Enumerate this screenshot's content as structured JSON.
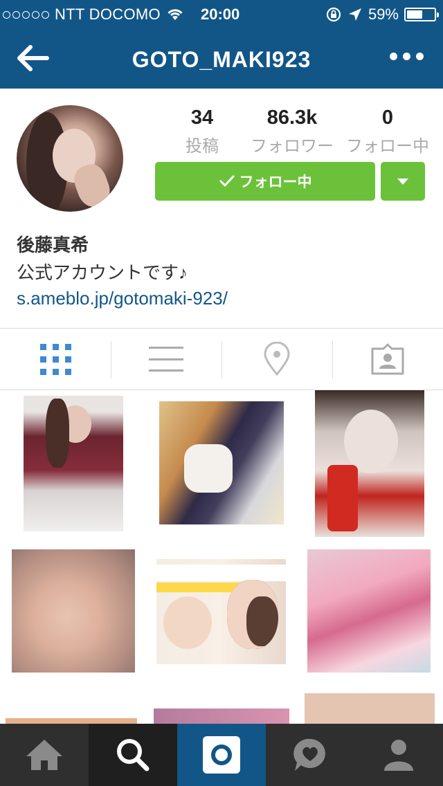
{
  "status_bar": {
    "carrier": "NTT DOCOMO",
    "time": "20:00",
    "battery": "59%",
    "battery_level": 0.59,
    "signal_bars": 0
  },
  "navbar": {
    "title": "GOTO_MAKI923",
    "back_icon": "arrow-left-icon",
    "more_icon": "more-dots-icon"
  },
  "profile": {
    "stats": [
      {
        "value": "34",
        "label": "投稿"
      },
      {
        "value": "86.3k",
        "label": "フォロワー"
      },
      {
        "value": "0",
        "label": "フォロー中"
      }
    ],
    "follow_button": "フォロー中",
    "full_name": "後藤真希",
    "bio": "公式アカウントです♪",
    "website": "s.ameblo.jp/gotomaki-923/"
  },
  "tabs": [
    {
      "icon": "grid-icon",
      "active": true
    },
    {
      "icon": "list-icon",
      "active": false
    },
    {
      "icon": "location-pin-icon",
      "active": false
    },
    {
      "icon": "tagged-person-icon",
      "active": false
    }
  ],
  "tabbar": [
    {
      "icon": "home-icon"
    },
    {
      "icon": "search-icon",
      "active": true
    },
    {
      "icon": "camera-icon"
    },
    {
      "icon": "activity-heart-icon"
    },
    {
      "icon": "profile-icon"
    }
  ],
  "colors": {
    "brand_blue": "#125688",
    "follow_green": "#6bc23a",
    "link_blue": "#125688",
    "active_tab_blue": "#3f89d1",
    "tabbar_dark": "#2f2f2f"
  }
}
